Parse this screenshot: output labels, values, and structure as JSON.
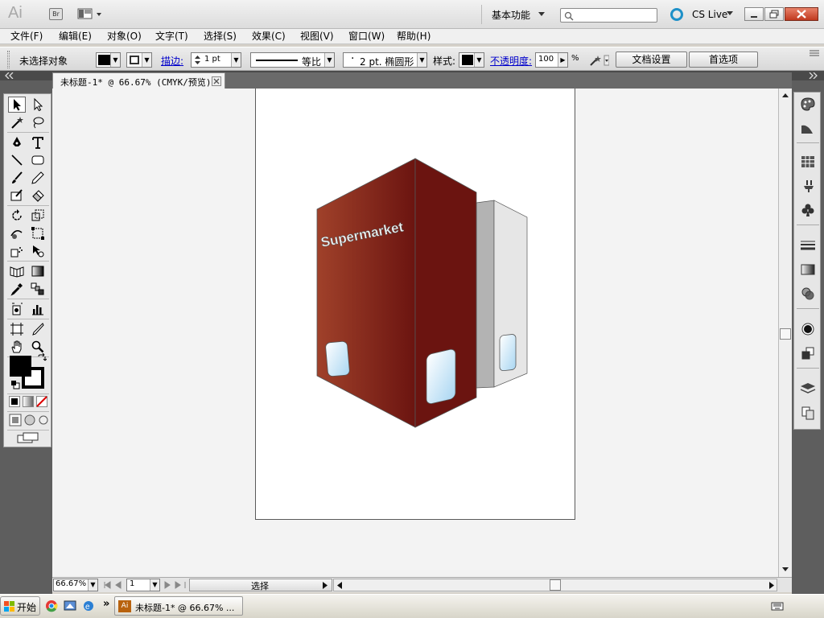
{
  "app": {
    "logo": "Ai",
    "bridge_label": "Br",
    "workspace": "基本功能",
    "cslive": "CS Live"
  },
  "menu": [
    "文件(F)",
    "编辑(E)",
    "对象(O)",
    "文字(T)",
    "选择(S)",
    "效果(C)",
    "视图(V)",
    "窗口(W)",
    "帮助(H)"
  ],
  "control": {
    "selection_status": "未选择对象",
    "stroke_label": "描边:",
    "stroke_weight": "1 pt",
    "stroke_profile": "等比",
    "brush": "2 pt. 椭圆形",
    "style_label": "样式:",
    "opacity_label": "不透明度:",
    "opacity_value": "100",
    "opacity_unit": "%",
    "doc_setup_button": "文档设置",
    "preferences_button": "首选项"
  },
  "document_tab": {
    "title": "未标题-1* @ 66.67% (CMYK/预览)"
  },
  "artwork": {
    "label": "Supermarket",
    "colors": {
      "front_left": "#a0412a",
      "front_right": "#6b1410",
      "back": "#e6e6e6",
      "window": "#cfe8f8"
    }
  },
  "status": {
    "zoom": "66.67%",
    "page": "1",
    "tool": "选择"
  },
  "taskbar": {
    "start": "开始",
    "task_title": "未标题-1* @ 66.67% ..."
  }
}
